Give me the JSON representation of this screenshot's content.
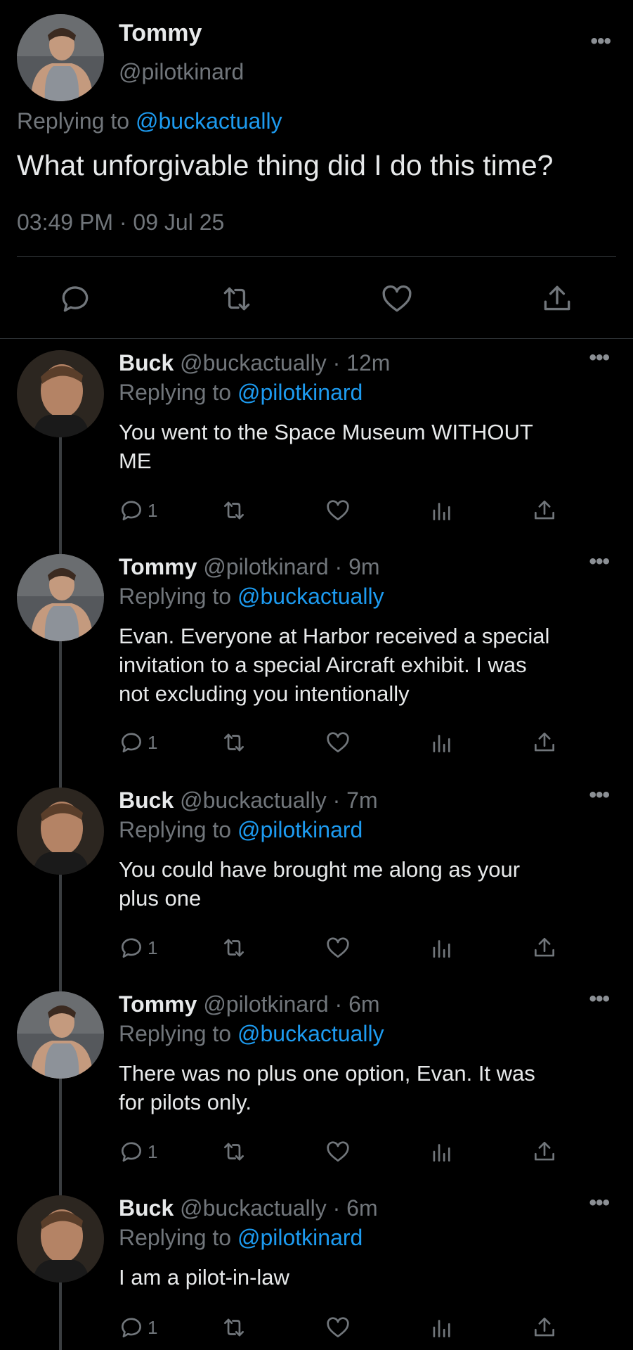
{
  "main_tweet": {
    "name": "Tommy",
    "handle": "@pilotkinard",
    "replying_prefix": "Replying to ",
    "replying_to": "@buckactually",
    "text": "What unforgivable thing did I do this time?",
    "timestamp": "03:49 PM · 09 Jul 25",
    "more": "•••",
    "actions": [
      "reply-icon",
      "retweet-icon",
      "like-icon",
      "share-icon"
    ]
  },
  "replies": [
    {
      "name": "Buck",
      "meta": "@buckactually · 12m",
      "replying_prefix": "Replying to ",
      "replying_to": "@pilotkinard",
      "text_lines": [
        "You went to the Space Museum WITHOUT",
        "ME"
      ],
      "reply_count": "1",
      "more": "•••"
    },
    {
      "name": "Tommy",
      "meta": "@pilotkinard · 9m",
      "replying_prefix": "Replying to ",
      "replying_to": "@buckactually",
      "text_lines": [
        "Evan. Everyone at Harbor received a special",
        "invitation to a special Aircraft exhibit. I was",
        "not excluding you intentionally"
      ],
      "reply_count": "1",
      "more": "•••"
    },
    {
      "name": "Buck",
      "meta": "@buckactually · 7m",
      "replying_prefix": "Replying to ",
      "replying_to": "@pilotkinard",
      "text_lines": [
        "You could have brought me along as your",
        "plus one"
      ],
      "reply_count": "1",
      "more": "•••"
    },
    {
      "name": "Tommy",
      "meta": "@pilotkinard · 6m",
      "replying_prefix": "Replying to ",
      "replying_to": "@buckactually",
      "text_lines": [
        "There was no plus one option, Evan. It was",
        "for pilots only."
      ],
      "reply_count": "1",
      "more": "•••"
    },
    {
      "name": "Buck",
      "meta": "@buckactually · 6m",
      "replying_prefix": "Replying to ",
      "replying_to": "@pilotkinard",
      "text_lines": [
        "I am a pilot-in-law"
      ],
      "reply_count": "1",
      "more": "•••"
    }
  ],
  "colors": {
    "background": "#000000",
    "text": "#e7e9ea",
    "muted": "#71767b",
    "link": "#1d9bf0",
    "divider": "#2f3336"
  }
}
